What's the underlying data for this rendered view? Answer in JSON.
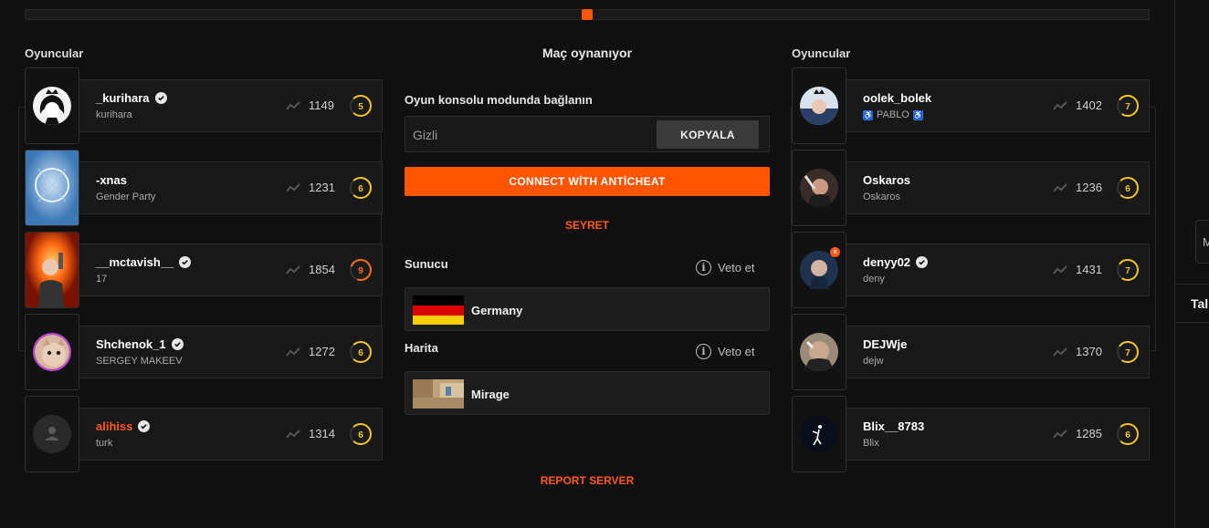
{
  "colors": {
    "accent": "#ff5500",
    "level_yellow": "#f5c518",
    "level_orange": "#ff6a13"
  },
  "left_team": {
    "title": "Oyuncular",
    "players": [
      {
        "name": "_kurihara",
        "sub": "kurihara",
        "elo": "1149",
        "level": "5",
        "verified": true
      },
      {
        "name": "-xnas",
        "sub": "Gender Party",
        "elo": "1231",
        "level": "6",
        "verified": false
      },
      {
        "name": "__mctavish__",
        "sub": "17",
        "elo": "1854",
        "level": "9",
        "verified": true
      },
      {
        "name": "Shchenok_1",
        "sub": "SERGEY MAKEEV",
        "elo": "1272",
        "level": "6",
        "verified": true
      },
      {
        "name": "alihiss",
        "sub": "turk",
        "elo": "1314",
        "level": "6",
        "verified": true
      }
    ]
  },
  "right_team": {
    "title": "Oyuncular",
    "players": [
      {
        "name": "oolek_bolek",
        "sub": "PABLO",
        "elo": "1402",
        "level": "7",
        "verified": false
      },
      {
        "name": "Oskaros",
        "sub": "Oskaros",
        "elo": "1236",
        "level": "6",
        "verified": false
      },
      {
        "name": "denyy02",
        "sub": "deny",
        "elo": "1431",
        "level": "7",
        "verified": true
      },
      {
        "name": "DEJWje",
        "sub": "dejw",
        "elo": "1370",
        "level": "7",
        "verified": false
      },
      {
        "name": "Blix__8783",
        "sub": "Blix",
        "elo": "1285",
        "level": "6",
        "verified": false
      }
    ]
  },
  "center": {
    "status": "Maç oynanıyor",
    "connect_label": "Oyun konsolu modunda bağlanın",
    "console_placeholder": "Gizli",
    "copy_label": "KOPYALA",
    "anticheat_label": "CONNECT WİTH ANTİCHEAT",
    "watch_label": "SEYRET",
    "server_label": "Sunucu",
    "map_label": "Harita",
    "veto_label": "Veto et",
    "server_value": "Germany",
    "map_value": "Mirage",
    "report_label": "REPORT SERVER"
  },
  "right_edge": {
    "box_text": "M",
    "tab_text": "Tal"
  }
}
